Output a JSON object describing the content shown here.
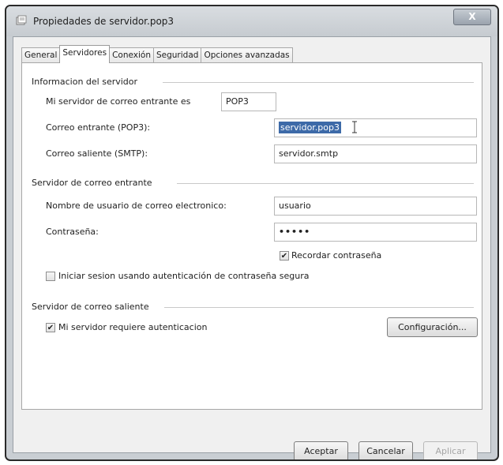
{
  "window": {
    "title": "Propiedades de servidor.pop3",
    "close_label": "X"
  },
  "tabs": [
    {
      "label": "General"
    },
    {
      "label": "Servidores"
    },
    {
      "label": "Conexión"
    },
    {
      "label": "Seguridad"
    },
    {
      "label": "Opciones avanzadas"
    }
  ],
  "server_info": {
    "group_title": "Informacion del servidor",
    "incoming_type_label": "Mi servidor de correo entrante es",
    "incoming_type_value": "POP3",
    "incoming_label": "Correo entrante (POP3):",
    "incoming_value": "servidor.pop3",
    "outgoing_label": "Correo saliente (SMTP):",
    "outgoing_value": "servidor.smtp"
  },
  "incoming_server": {
    "group_title": "Servidor de correo entrante",
    "username_label": "Nombre de usuario de correo electronico:",
    "username_value": "usuario",
    "password_label": "Contraseña:",
    "password_value": "•••••",
    "remember_label": "Recordar contraseña",
    "remember_checked": true,
    "spa_label": "Iniciar sesion usando autenticación de contraseña segura",
    "spa_checked": false
  },
  "outgoing_server": {
    "group_title": "Servidor de correo saliente",
    "auth_label": "Mi servidor requiere autenticacion",
    "auth_checked": true,
    "settings_button": "Configuración..."
  },
  "buttons": {
    "ok": "Aceptar",
    "cancel": "Cancelar",
    "apply": "Aplicar"
  }
}
